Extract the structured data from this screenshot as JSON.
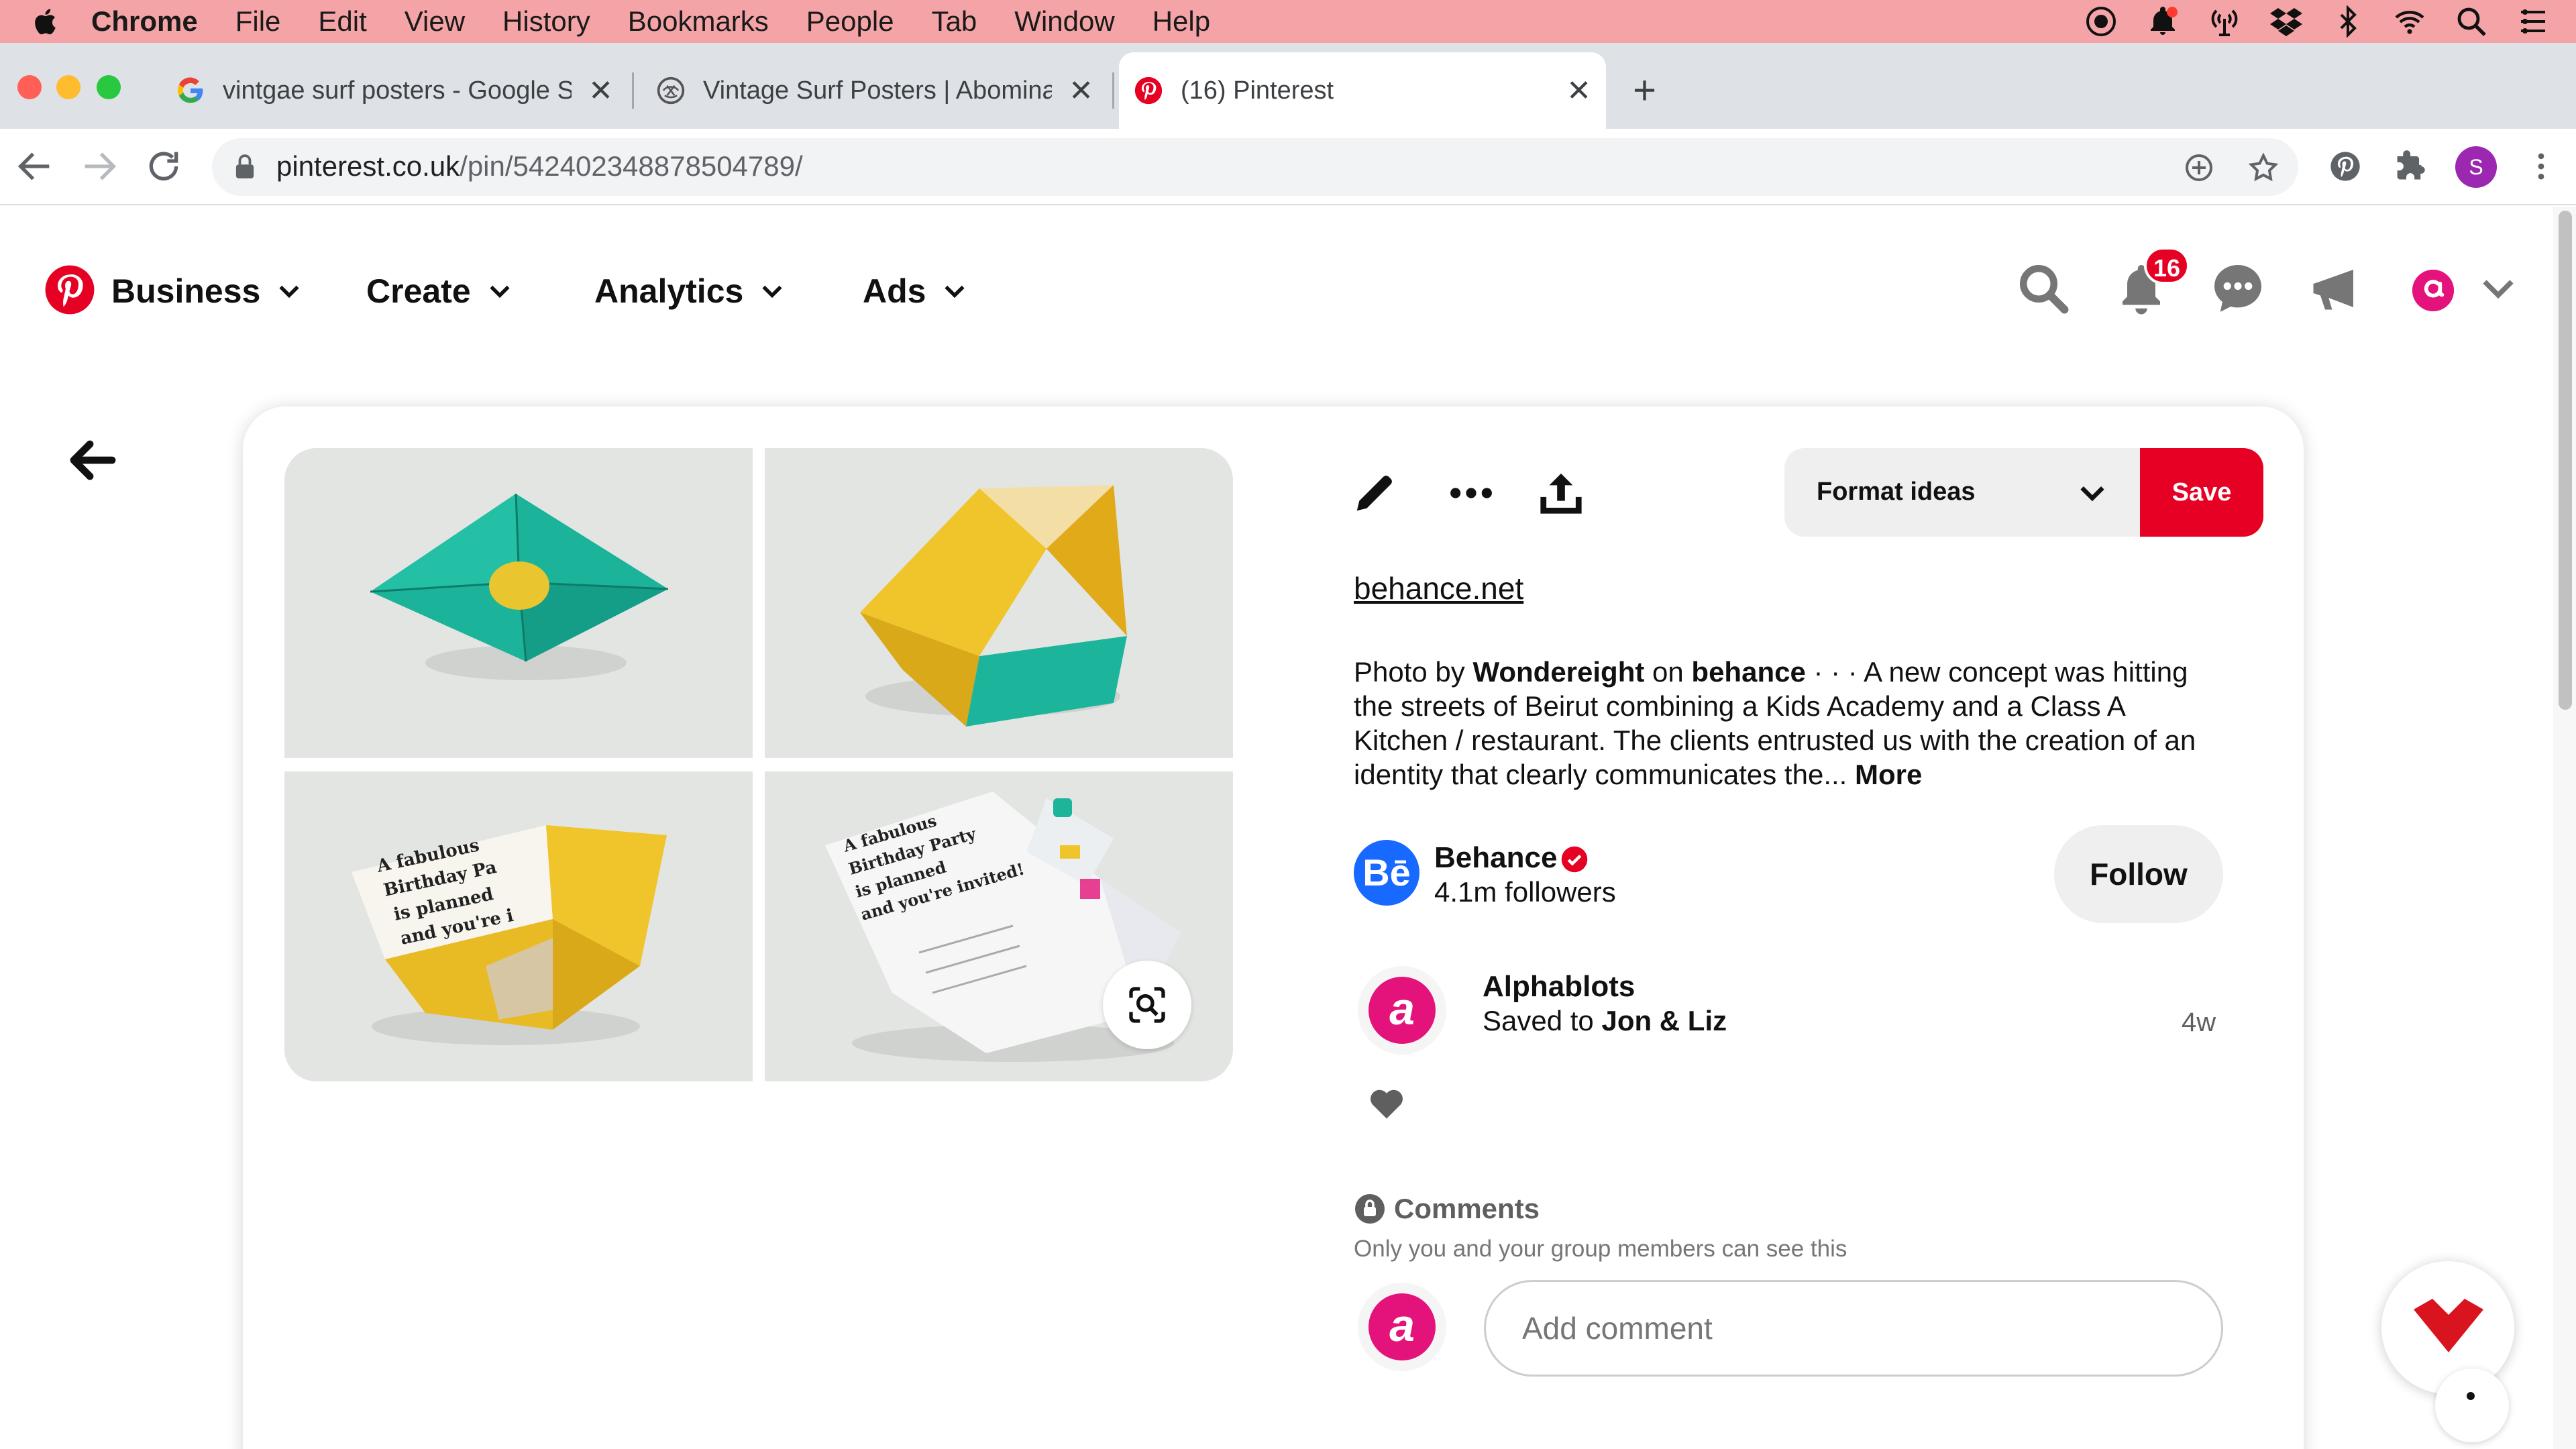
{
  "menubar": {
    "items": [
      "Chrome",
      "File",
      "Edit",
      "View",
      "History",
      "Bookmarks",
      "People",
      "Tab",
      "Window",
      "Help"
    ]
  },
  "tabs": [
    {
      "title": "vintgae surf posters - Google S",
      "icon": "google-icon",
      "close": "✕"
    },
    {
      "title": "Vintage Surf Posters | Abomina",
      "icon": "abomination-icon",
      "close": "✕"
    },
    {
      "title": "(16) Pinterest",
      "icon": "pinterest-icon",
      "close": "✕"
    }
  ],
  "newtab_label": "+",
  "omnibox": {
    "domain": "pinterest.co.uk",
    "path": "/pin/542402348878504789/"
  },
  "profile_initial": "S",
  "pin_nav": {
    "items": [
      "Business",
      "Create",
      "Analytics",
      "Ads"
    ]
  },
  "notifications_count": "16",
  "pin": {
    "board": "Format ideas",
    "save_label": "Save",
    "domain": "behance.net",
    "desc_prefix": "Photo by ",
    "desc_author": "Wondereight",
    "desc_on": " on ",
    "desc_source": "behance",
    "desc_body": " · · · A new concept was hitting the streets of Beirut combining a Kids Academy and a Class A Kitchen / restaurant. The clients entrusted us with the creation of an identity that clearly communicates the... ",
    "more_label": "More",
    "image_text_1": "A fabulous Birthday Pa is planned and you're i",
    "image_text_2": "A fabulous Birthday Party is planned and you're invited!"
  },
  "creator": {
    "avatar_text": "Bē",
    "name": "Behance",
    "followers": "4.1m followers",
    "follow_label": "Follow"
  },
  "saver": {
    "avatar_text": "a",
    "name": "Alphablots",
    "saved_prefix": "Saved to ",
    "board": "Jon & Liz",
    "age": "4w"
  },
  "comments": {
    "title": "Comments",
    "note": "Only you and your group members can see this",
    "placeholder": "Add comment",
    "avatar_text": "a"
  },
  "colors": {
    "pinterest_red": "#e60023",
    "menubar_bg": "#f4a3a6",
    "behance_blue": "#1769ff",
    "avatar_pink": "#e3137b"
  }
}
